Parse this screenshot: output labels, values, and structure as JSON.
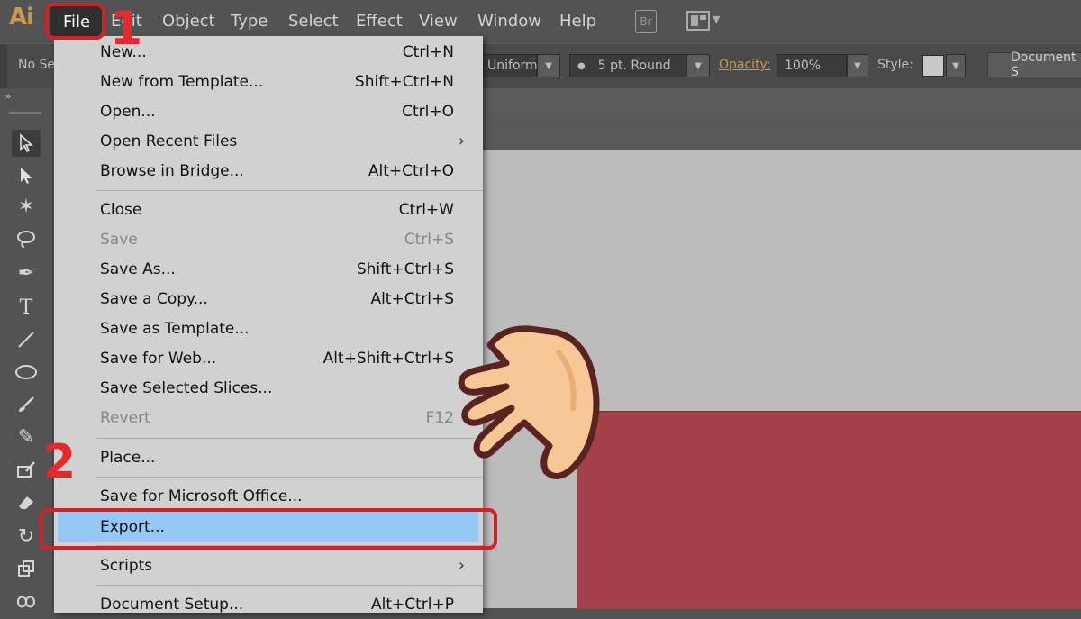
{
  "app": {
    "logo": "Ai",
    "menus": [
      "File",
      "Edit",
      "Object",
      "Type",
      "Select",
      "Effect",
      "View",
      "Window",
      "Help"
    ],
    "bridge_icon": "Br"
  },
  "control_bar": {
    "no_selection_label": "No Se",
    "stroke_profile": "Uniform",
    "brush": "5 pt. Round",
    "opacity_label": "Opacity:",
    "opacity_value": "100%",
    "style_label": "Style:",
    "document_button": "Document S"
  },
  "file_menu": {
    "items": [
      {
        "label": "New...",
        "shortcut": "Ctrl+N",
        "enabled": true
      },
      {
        "label": "New from Template...",
        "shortcut": "Shift+Ctrl+N",
        "enabled": true
      },
      {
        "label": "Open...",
        "shortcut": "Ctrl+O",
        "enabled": true
      },
      {
        "label": "Open Recent Files",
        "shortcut": "",
        "submenu": true,
        "enabled": true
      },
      {
        "label": "Browse in Bridge...",
        "shortcut": "Alt+Ctrl+O",
        "enabled": true
      },
      {
        "label": "Close",
        "shortcut": "Ctrl+W",
        "enabled": true
      },
      {
        "label": "Save",
        "shortcut": "Ctrl+S",
        "enabled": false
      },
      {
        "label": "Save As...",
        "shortcut": "Shift+Ctrl+S",
        "enabled": true
      },
      {
        "label": "Save a Copy...",
        "shortcut": "Alt+Ctrl+S",
        "enabled": true
      },
      {
        "label": "Save as Template...",
        "shortcut": "",
        "enabled": true
      },
      {
        "label": "Save for Web...",
        "shortcut": "Alt+Shift+Ctrl+S",
        "enabled": true
      },
      {
        "label": "Save Selected Slices...",
        "shortcut": "",
        "enabled": true
      },
      {
        "label": "Revert",
        "shortcut": "F12",
        "enabled": false
      },
      {
        "label": "Place...",
        "shortcut": "",
        "enabled": true
      },
      {
        "label": "Save for Microsoft Office...",
        "shortcut": "",
        "enabled": true
      },
      {
        "label": "Export...",
        "shortcut": "",
        "enabled": true,
        "highlighted": true
      },
      {
        "label": "Scripts",
        "shortcut": "",
        "submenu": true,
        "enabled": true
      },
      {
        "label": "Document Setup...",
        "shortcut": "Alt+Ctrl+P",
        "enabled": true
      }
    ]
  },
  "annotations": {
    "step1": "1",
    "step2": "2"
  },
  "colors": {
    "highlight": "#96c8f6",
    "annotation_red": "#d42026",
    "artwork_red": "#a3414a",
    "menu_bg": "#d1d1d1",
    "app_bg": "#535353"
  }
}
